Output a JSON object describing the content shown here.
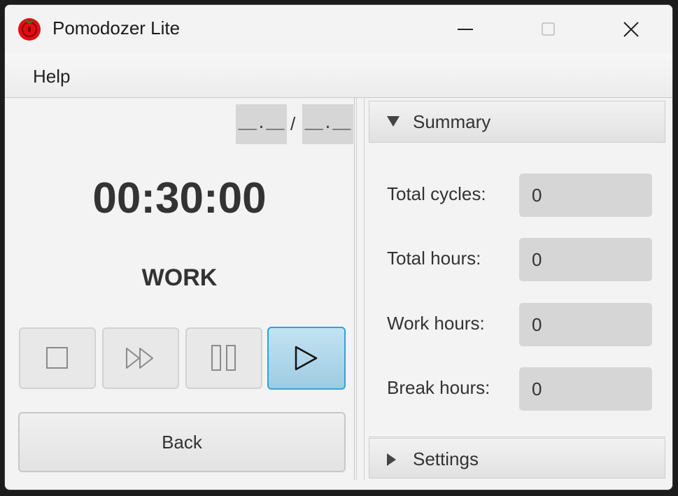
{
  "window": {
    "title": "Pomodozer Lite",
    "icon": "tomato-icon"
  },
  "menu": {
    "items": [
      {
        "label": "Help"
      }
    ]
  },
  "timer": {
    "start_time": "__.__",
    "separator": "/",
    "end_time": "__.__",
    "countdown": "00:30:00",
    "phase": "WORK"
  },
  "controls": {
    "stop_icon": "stop-icon",
    "skip_icon": "skip-icon",
    "pause_icon": "pause-icon",
    "play_icon": "play-icon",
    "back_label": "Back",
    "accent_color": "#2aa5dc"
  },
  "summary": {
    "title": "Summary",
    "expanded": true,
    "rows": [
      {
        "label": "Total cycles:",
        "value": "0"
      },
      {
        "label": "Total hours:",
        "value": "0"
      },
      {
        "label": "Work hours:",
        "value": "0"
      },
      {
        "label": "Break hours:",
        "value": "0"
      }
    ]
  },
  "settings": {
    "title": "Settings",
    "expanded": false
  }
}
